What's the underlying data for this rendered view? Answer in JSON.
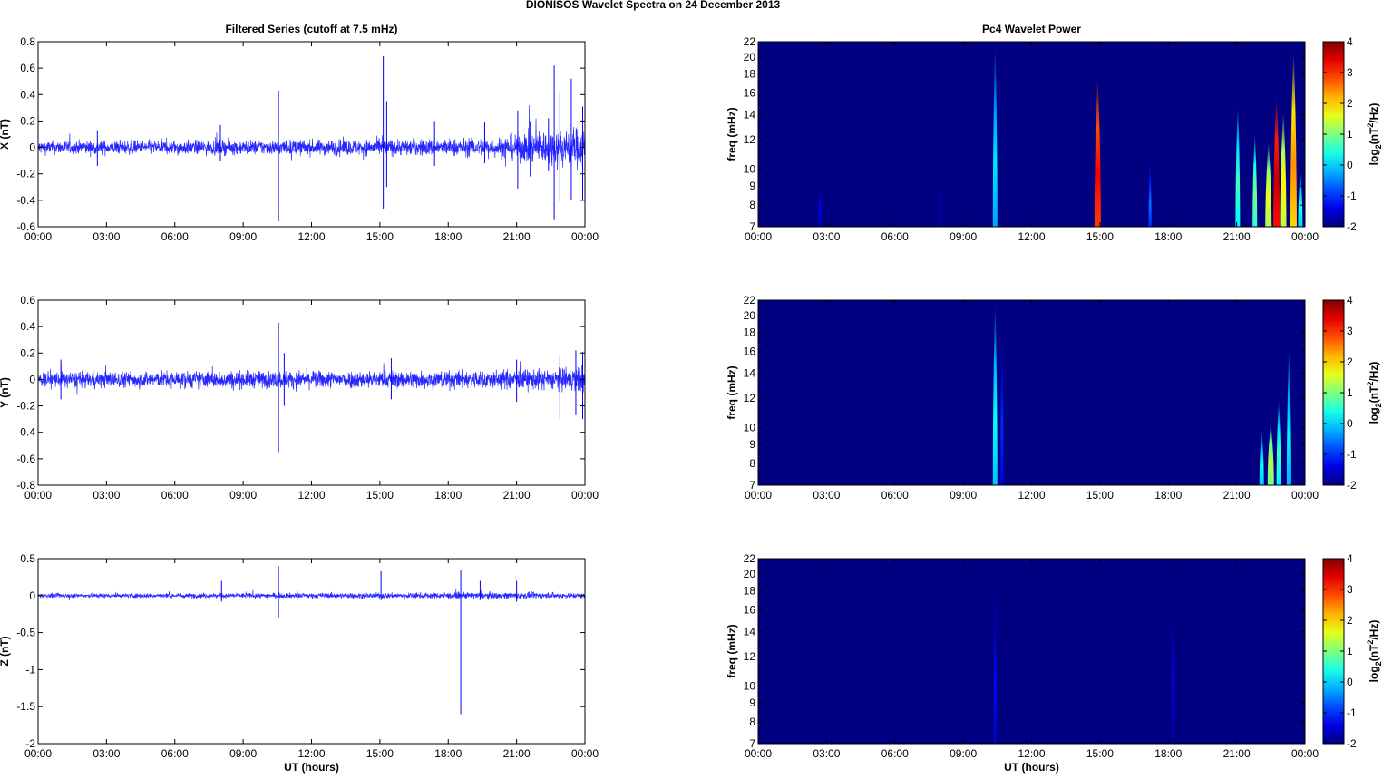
{
  "title": "DIONISOS Wavelet Spectra on 24 December  2013",
  "chart_data": [
    {
      "type": "line",
      "title": "Filtered Series (cutoff at 7.5 mHz)",
      "ylabel": "X (nT)",
      "xlabel": "",
      "xlim": [
        0,
        24
      ],
      "ylim": [
        -0.6,
        0.8
      ],
      "yticks": [
        "-0.6",
        "-0.4",
        "-0.2",
        "0",
        "0.2",
        "0.4",
        "0.6",
        "0.8"
      ],
      "xtick_labels": [
        "00:00",
        "03:00",
        "06:00",
        "09:00",
        "12:00",
        "15:00",
        "18:00",
        "21:00",
        "00:00"
      ],
      "noise_envelope": [
        [
          0,
          0.05
        ],
        [
          10,
          0.055
        ],
        [
          15,
          0.06
        ],
        [
          20,
          0.07
        ],
        [
          21,
          0.1
        ],
        [
          22.5,
          0.14
        ],
        [
          24,
          0.16
        ]
      ],
      "spikes": [
        [
          2.6,
          0.13,
          -0.14
        ],
        [
          8,
          0.17,
          -0.1
        ],
        [
          10.55,
          0.43,
          -0.56
        ],
        [
          15.15,
          0.69,
          -0.47
        ],
        [
          15.3,
          0.35,
          -0.3
        ],
        [
          17.4,
          0.2,
          -0.14
        ],
        [
          19.6,
          0.19,
          -0.12
        ],
        [
          21.05,
          0.28,
          -0.31
        ],
        [
          21.6,
          0.2,
          -0.22
        ],
        [
          22.4,
          0.22,
          -0.18
        ],
        [
          22.65,
          0.62,
          -0.55
        ],
        [
          22.9,
          0.42,
          -0.41
        ],
        [
          23.4,
          0.52,
          -0.4
        ],
        [
          23.9,
          0.31,
          -0.4
        ]
      ]
    },
    {
      "type": "line",
      "title": "",
      "ylabel": "Y (nT)",
      "xlabel": "",
      "xlim": [
        0,
        24
      ],
      "ylim": [
        -0.8,
        0.6
      ],
      "yticks": [
        "-0.8",
        "-0.6",
        "-0.4",
        "-0.2",
        "0",
        "0.2",
        "0.4",
        "0.6"
      ],
      "xtick_labels": [
        "00:00",
        "03:00",
        "06:00",
        "09:00",
        "12:00",
        "15:00",
        "18:00",
        "21:00",
        "00:00"
      ],
      "noise_envelope": [
        [
          0,
          0.06
        ],
        [
          10,
          0.065
        ],
        [
          15,
          0.065
        ],
        [
          20,
          0.07
        ],
        [
          22.5,
          0.08
        ],
        [
          24,
          0.1
        ]
      ],
      "spikes": [
        [
          1,
          0.15,
          -0.15
        ],
        [
          10.55,
          0.43,
          -0.55
        ],
        [
          10.8,
          0.2,
          -0.2
        ],
        [
          15.5,
          0.16,
          -0.15
        ],
        [
          21,
          0.15,
          -0.17
        ],
        [
          22.9,
          0.18,
          -0.3
        ],
        [
          23.6,
          0.22,
          -0.27
        ],
        [
          23.9,
          0.21,
          -0.3
        ]
      ]
    },
    {
      "type": "line",
      "title": "",
      "ylabel": "Z (nT)",
      "xlabel": "UT (hours)",
      "xlim": [
        0,
        24
      ],
      "ylim": [
        -2,
        0.5
      ],
      "yticks": [
        "-2",
        "-1.5",
        "-1",
        "-0.5",
        "0",
        "0.5"
      ],
      "xtick_labels": [
        "00:00",
        "03:00",
        "06:00",
        "09:00",
        "12:00",
        "15:00",
        "18:00",
        "21:00",
        "00:00"
      ],
      "noise_envelope": [
        [
          0,
          0.03
        ],
        [
          12,
          0.035
        ],
        [
          18,
          0.04
        ],
        [
          21,
          0.045
        ],
        [
          24,
          0.035
        ]
      ],
      "spikes": [
        [
          8.05,
          0.2,
          -0.08
        ],
        [
          10.55,
          0.4,
          -0.3
        ],
        [
          15.05,
          0.33,
          -0.06
        ],
        [
          18.55,
          0.35,
          -1.6
        ],
        [
          19.4,
          0.2,
          -0.06
        ],
        [
          21,
          0.2,
          -0.08
        ]
      ]
    },
    {
      "type": "heatmap",
      "title": "Pc4 Wavelet Power",
      "ylabel": "freq (mHz)",
      "xlabel": "",
      "xlim": [
        0,
        24
      ],
      "ylim": [
        7,
        22
      ],
      "yscale": "log",
      "yticks": [
        "7",
        "8",
        "9",
        "10",
        "12",
        "14",
        "16",
        "18",
        "20",
        "22"
      ],
      "xtick_labels": [
        "00:00",
        "03:00",
        "06:00",
        "09:00",
        "12:00",
        "15:00",
        "18:00",
        "21:00",
        "00:00"
      ],
      "colorbar": {
        "label_base": "log",
        "label_sub": "2",
        "label_mid": "(nT",
        "label_sup": "2",
        "label_end": "/Hz)",
        "range": [
          -2,
          4
        ],
        "ticks": [
          "-2",
          "-1",
          "0",
          "1",
          "2",
          "3",
          "4"
        ]
      },
      "background_power": -2,
      "events": [
        [
          2.7,
          9.6,
          -1.3
        ],
        [
          8,
          10.2,
          -1.5
        ],
        [
          10.4,
          22,
          0.1
        ],
        [
          14.9,
          18,
          3.3
        ],
        [
          17.2,
          10.6,
          -0.6
        ],
        [
          21.05,
          15,
          0.6
        ],
        [
          21.8,
          12.6,
          0.9
        ],
        [
          22.4,
          12,
          1.6
        ],
        [
          22.75,
          16,
          3.6
        ],
        [
          23.05,
          14.5,
          1.8
        ],
        [
          23.5,
          21,
          2.4
        ],
        [
          23.8,
          10,
          0.4
        ]
      ]
    },
    {
      "type": "heatmap",
      "title": "",
      "ylabel": "freq (mHz)",
      "xlabel": "",
      "xlim": [
        0,
        24
      ],
      "ylim": [
        7,
        22
      ],
      "yscale": "log",
      "yticks": [
        "7",
        "8",
        "9",
        "10",
        "12",
        "14",
        "16",
        "18",
        "20",
        "22"
      ],
      "xtick_labels": [
        "00:00",
        "03:00",
        "06:00",
        "09:00",
        "12:00",
        "15:00",
        "18:00",
        "21:00",
        "00:00"
      ],
      "colorbar": {
        "label_base": "log",
        "label_sub": "2",
        "label_mid": "(nT",
        "label_sup": "2",
        "label_end": "/Hz)",
        "range": [
          -2,
          4
        ],
        "ticks": [
          "-2",
          "-1",
          "0",
          "1",
          "2",
          "3",
          "4"
        ]
      },
      "background_power": -2,
      "events": [
        [
          10.4,
          22,
          0.3
        ],
        [
          10.7,
          20,
          -1
        ],
        [
          22.1,
          10,
          0.3
        ],
        [
          22.5,
          10.5,
          1.3
        ],
        [
          22.85,
          12,
          0.6
        ],
        [
          23.3,
          16.5,
          0.2
        ]
      ]
    },
    {
      "type": "heatmap",
      "title": "",
      "ylabel": "freq (mHz)",
      "xlabel": "UT (hours)",
      "xlim": [
        0,
        24
      ],
      "ylim": [
        7,
        22
      ],
      "yscale": "log",
      "yticks": [
        "7",
        "8",
        "9",
        "10",
        "12",
        "14",
        "16",
        "18",
        "20",
        "22"
      ],
      "xtick_labels": [
        "00:00",
        "03:00",
        "06:00",
        "09:00",
        "12:00",
        "15:00",
        "18:00",
        "21:00",
        "00:00"
      ],
      "colorbar": {
        "label_base": "log",
        "label_sub": "2",
        "label_mid": "(nT",
        "label_sup": "2",
        "label_end": "/Hz)",
        "range": [
          -2,
          4
        ],
        "ticks": [
          "-2",
          "-1",
          "0",
          "1",
          "2",
          "3",
          "4"
        ]
      },
      "background_power": -2,
      "events": [
        [
          10.4,
          21,
          -1.2
        ],
        [
          18.2,
          22,
          -1.4
        ]
      ]
    }
  ]
}
